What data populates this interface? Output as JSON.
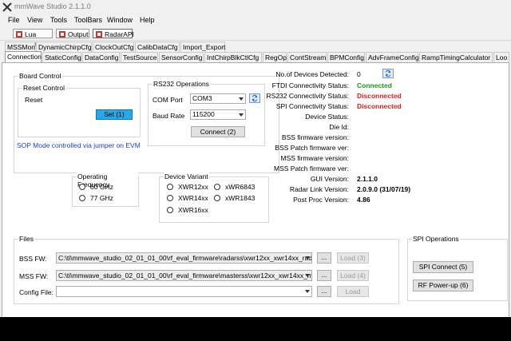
{
  "window": {
    "title": "mmWave Studio 2.1.1.0"
  },
  "menu": [
    "File",
    "View",
    "Tools",
    "ToolBars",
    "Window",
    "Help"
  ],
  "toolbar": [
    "Lua Shell",
    "Output",
    "RadarAPI"
  ],
  "tabs_row1": [
    "MSSMon",
    "DynamicChirpCfg",
    "ClockOutCfg",
    "CalibDataCfg",
    "Import_Export"
  ],
  "tabs_row2": [
    "Connection",
    "StaticConfig",
    "DataConfig",
    "TestSource",
    "SensorConfig",
    "IntChirpBlkCtlCfg",
    "RegOp",
    "ContStream",
    "BPMConfig",
    "AdvFrameConfig",
    "RampTimingCalculator",
    "Loo"
  ],
  "board_control": {
    "title": "Board Control",
    "reset_title": "Reset Control",
    "reset_label": "Reset",
    "set_button": "Set (1)",
    "sop_note": "SOP Mode controlled via jumper on EVM"
  },
  "rs232": {
    "title": "RS232 Operations",
    "com_label": "COM Port",
    "com_value": "COM3",
    "baud_label": "Baud Rate",
    "baud_value": "115200",
    "connect_button": "Connect (2)"
  },
  "freq": {
    "title": "Operating Frequency",
    "opt1": "60 GHz",
    "opt2": "77 GHz"
  },
  "device": {
    "title": "Device Variant",
    "opt1": "XWR12xx",
    "opt2": "XWR14xx",
    "opt3": "XWR16xx",
    "opt4": "xWR6843",
    "opt5": "xWR1843"
  },
  "status": {
    "devices_label": "No.of Devices Detected:",
    "devices_value": "0",
    "ftdi_label": "FTDI Connectivity Status:",
    "ftdi_value": "Connected",
    "rs232_label": "RS232 Connectivity Status:",
    "rs232_value": "Disconnected",
    "spi_label": "SPI Connectivity Status:",
    "spi_value": "Disconnected",
    "device_status_label": "Device Status:",
    "die_id_label": "Die Id:",
    "bss_fw_label": "BSS firmware version:",
    "bss_patch_label": "BSS Patch firmware ver:",
    "mss_fw_label": "MSS firmware version:",
    "mss_patch_label": "MSS Patch firmware ver:",
    "gui_label": "GUI Version:",
    "gui_value": "2.1.1.0",
    "radar_label": "Radar Link Version:",
    "radar_value": "2.0.9.0 (31/07/19)",
    "postproc_label": "Post Proc Version:",
    "postproc_value": "4.86",
    "connected_color": "#1a9a1a",
    "disconnected_color": "#e02020"
  },
  "files": {
    "title": "Files",
    "bss_label": "BSS FW:",
    "bss_value": "C:\\ti\\mmwave_studio_02_01_01_00\\rf_eval_firmware\\radarss\\xwr12xx_xwr14xx_radarss",
    "bss_load": "Load (3)",
    "mss_label": "MSS FW:",
    "mss_value": "C:\\ti\\mmwave_studio_02_01_01_00\\rf_eval_firmware\\masterss\\xwr12xx_xwr14xx_mas",
    "mss_load": "Load (4)",
    "config_label": "Config File:",
    "config_value": "",
    "config_load": "Load",
    "browse": "..."
  },
  "spi": {
    "title": "SPI Operations",
    "connect": "SPI Connect (5)",
    "powerup": "RF Power-up (6)"
  }
}
